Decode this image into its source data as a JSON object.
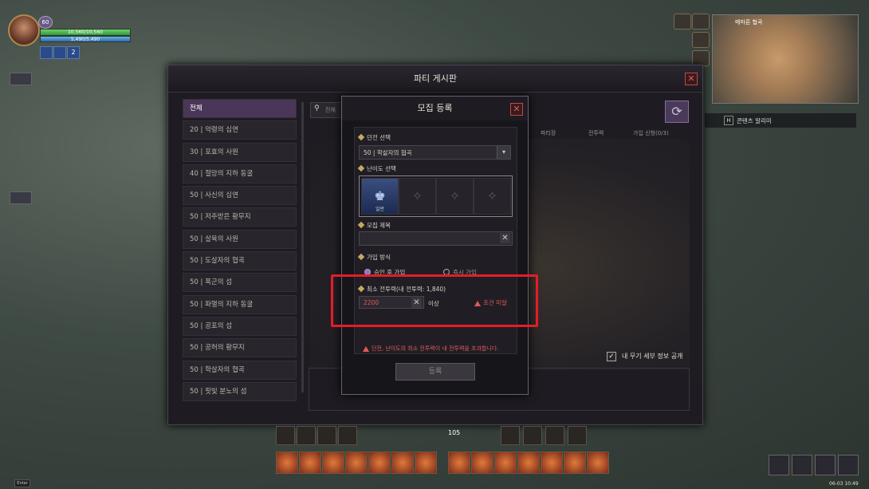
{
  "player": {
    "hp_text": "10,560/10,560",
    "mp_text": "5,490/5,490",
    "buff_count": "2"
  },
  "minimap": {
    "region": "메마른 협곡"
  },
  "quest": {
    "key": "H",
    "text": "콘텐츠 알리미"
  },
  "board": {
    "title": "파티 게시판",
    "search_placeholder": "전체",
    "categories": [
      "전체",
      "20 | 악령의 심연",
      "30 | 포효의 사원",
      "40 | 절망의 지하 동굴",
      "50 | 사신의 심연",
      "50 | 저주받은 황무지",
      "50 | 살육의 사원",
      "50 | 도살자의 협곡",
      "50 | 폭군의 섬",
      "50 | 파멸의 지하 동굴",
      "50 | 공포의 섬",
      "50 | 공허의 황무지",
      "50 | 학살자의 협곡",
      "50 | 핏빛 분노의 섬"
    ],
    "columns": {
      "party": "파티장",
      "power": "전투력",
      "apply": "가입 신청(0/3)"
    },
    "weapon_info_label": "내 무기 세부 정보 공개"
  },
  "dialog": {
    "title": "모집 등록",
    "dungeon_label": "던전 선택",
    "dungeon_value": "50 | 학살자의 협곡",
    "difficulty_label": "난이도 선택",
    "difficulty_selected": "일반",
    "title_label": "모집 제목",
    "join_label": "가입 방식",
    "join_opt1": "승인 후 가입",
    "join_opt2": "즉시 가입",
    "power_label": "최소 전투력(내 전투력: 1,840)",
    "power_value": "2200",
    "power_suffix": "이상",
    "power_warning": "조건 미달",
    "error_text": "던전, 난이도의 최소 전투력이 내 전투력을 초과합니다.",
    "submit": "등록"
  },
  "hud": {
    "ammo": "105",
    "chat": "Enter",
    "clock": "06-03 10:49"
  },
  "colors": {
    "accent": "#4a3658",
    "warning": "#e05a5a",
    "highlight": "#e61c28"
  }
}
